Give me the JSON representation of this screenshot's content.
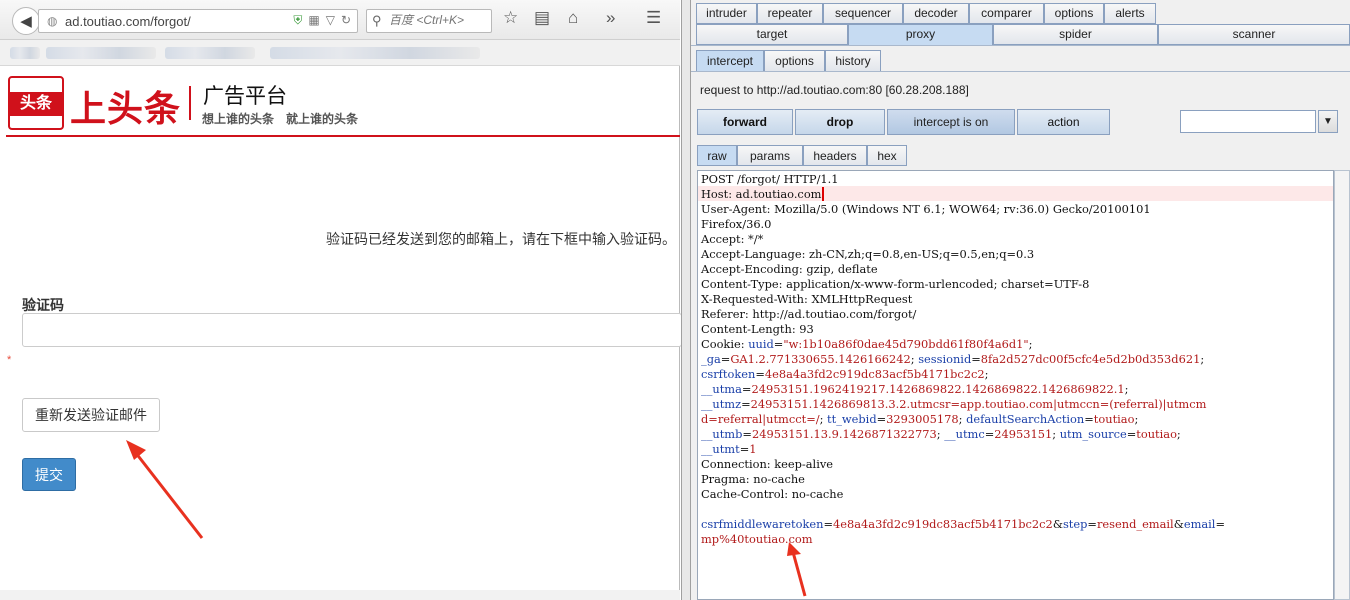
{
  "browser": {
    "url": "ad.toutiao.com/forgot/",
    "search_placeholder": "百度 <Ctrl+K>"
  },
  "site": {
    "logo_text": "头条",
    "brand": "上头条",
    "sub": "广告平台",
    "slogan": "想上谁的头条　就上谁的头条",
    "accent": "#d0111b"
  },
  "form": {
    "notice": "验证码已经发送到您的邮箱上，请在下框中输入验证码。",
    "code_label": "验证码",
    "code_value": "",
    "required_mark": "*",
    "resend_label": "重新发送验证邮件",
    "submit_label": "提交",
    "submit_color": "#428bca"
  },
  "burp": {
    "top_tabs_row1": [
      "intruder",
      "repeater",
      "sequencer",
      "decoder",
      "comparer",
      "options",
      "alerts"
    ],
    "top_tabs_row2": [
      "target",
      "proxy",
      "spider",
      "scanner"
    ],
    "proxy_tabs": [
      "intercept",
      "options",
      "history"
    ],
    "request_info": "request to http://ad.toutiao.com:80  [60.28.208.188]",
    "buttons": {
      "forward": "forward",
      "drop": "drop",
      "intercept": "intercept is on",
      "action": "action"
    },
    "search_value": "",
    "dropdown_glyph": "▼",
    "view_tabs": [
      "raw",
      "params",
      "headers",
      "hex"
    ],
    "request_lines": [
      "POST /forgot/ HTTP/1.1",
      "Host: ad.toutiao.com",
      "User-Agent: Mozilla/5.0 (Windows NT 6.1; WOW64; rv:36.0) Gecko/20100101",
      "Firefox/36.0",
      "Accept: */*",
      "Accept-Language: zh-CN,zh;q=0.8,en-US;q=0.5,en;q=0.3",
      "Accept-Encoding: gzip, deflate",
      "Content-Type: application/x-www-form-urlencoded; charset=UTF-8",
      "X-Requested-With: XMLHttpRequest",
      "Referer: http://ad.toutiao.com/forgot/",
      "Content-Length: 93"
    ],
    "cookie_prefix": "Cookie: ",
    "cookie_parts": [
      {
        "k": "uuid",
        "v": "\"w:1b10a86f0dae45d790bdd61f80f4a6d1\"",
        "sep": "; "
      },
      {
        "k": "\n_ga",
        "v": "GA1.2.771330655.1426166242",
        "sep": "; "
      },
      {
        "k": "sessionid",
        "v": "8fa2d527dc00f5cfc4e5d2b0d353d621",
        "sep": ";\n"
      },
      {
        "k": "csrftoken",
        "v": "4e8a4a3fd2c919dc83acf5b4171bc2c2",
        "sep": ";\n"
      },
      {
        "k": "__utma",
        "v": "24953151.1962419217.1426869822.1426869822.1426869822.1",
        "sep": ";\n"
      },
      {
        "k": "__utmz",
        "v": "24953151.1426869813.3.2.utmcsr=app.toutiao.com|utmccn=(referral)|utmcm\nd=referral|utmcct=/",
        "sep": "; "
      },
      {
        "k": "tt_webid",
        "v": "3293005178",
        "sep": "; "
      },
      {
        "k": "defaultSearchAction",
        "v": "toutiao",
        "sep": ";\n"
      },
      {
        "k": "__utmb",
        "v": "24953151.13.9.1426871322773",
        "sep": "; "
      },
      {
        "k": "__utmc",
        "v": "24953151",
        "sep": "; "
      },
      {
        "k": "utm_source",
        "v": "toutiao",
        "sep": ";\n"
      },
      {
        "k": "__utmt",
        "v": "1",
        "sep": ""
      }
    ],
    "request_tail": [
      "Connection: keep-alive",
      "Pragma: no-cache",
      "Cache-Control: no-cache",
      ""
    ],
    "body_parts": [
      {
        "k": "csrfmiddlewaretoken",
        "v": "4e8a4a3fd2c919dc83acf5b4171bc2c2",
        "sep": "&"
      },
      {
        "k": "step",
        "v": "resend_email",
        "sep": "&"
      },
      {
        "k": "email",
        "v": "\nmp%40toutiao.com",
        "sep": ""
      }
    ]
  }
}
